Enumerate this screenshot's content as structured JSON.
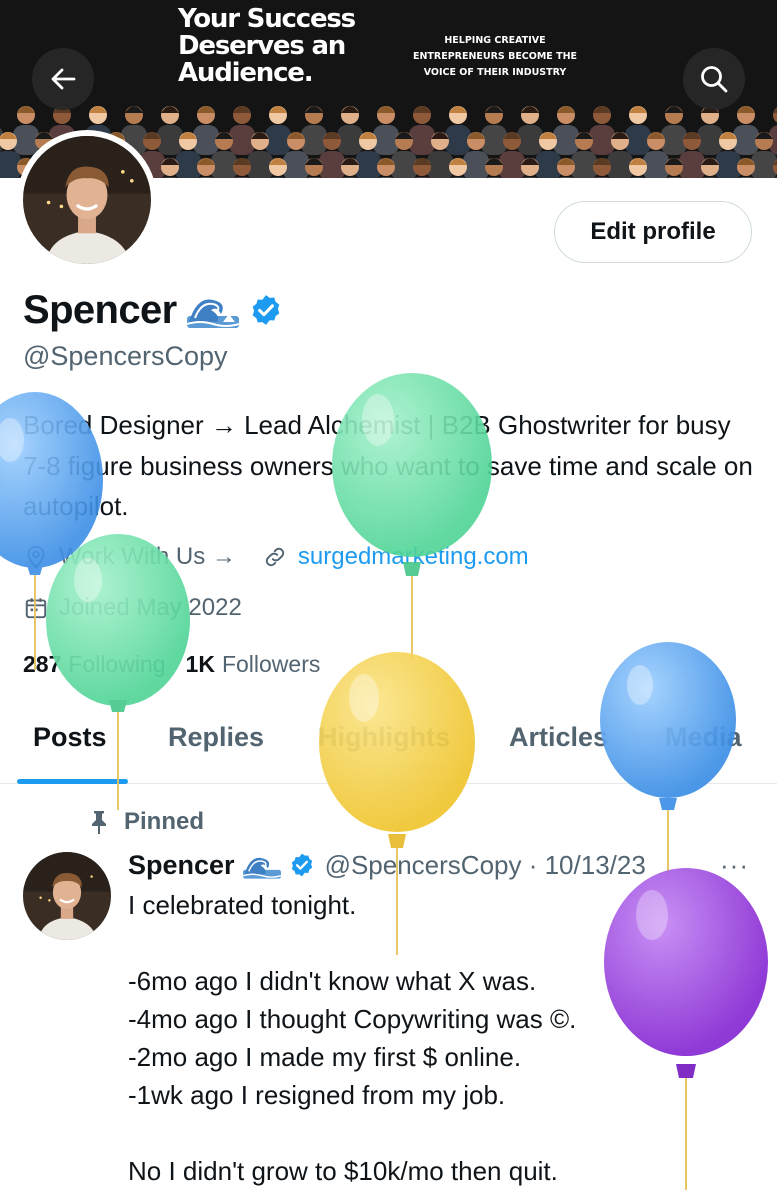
{
  "banner": {
    "title": "Your Success\nDeserves an\nAudience.",
    "tagline": "HELPING CREATIVE\nENTREPRENEURS BECOME THE\nVOICE OF THEIR INDUSTRY"
  },
  "nav": {
    "back_icon": "arrow-left-icon",
    "search_icon": "search-icon"
  },
  "profile": {
    "edit_label": "Edit profile",
    "display_name": "Spencer",
    "handle": "@SpencersCopy",
    "bio": "Bored Designer → Lead Alchemist | B2B Ghostwriter for busy 7-8 figure business owners who want to save time and scale on autopilot.",
    "work_label": "Work With Us →",
    "website": "surgedmarketing.com",
    "joined": "Joined May 2022",
    "following_count": "287",
    "following_label": "Following",
    "followers_count": "1K",
    "followers_label": "Followers"
  },
  "tabs": [
    {
      "label": "Posts",
      "active": true
    },
    {
      "label": "Replies",
      "active": false
    },
    {
      "label": "Highlights",
      "active": false
    },
    {
      "label": "Articles",
      "active": false
    },
    {
      "label": "Media",
      "active": false
    }
  ],
  "post": {
    "pinned_label": "Pinned",
    "author_name": "Spencer",
    "author_handle_date": "@SpencersCopy · 10/13/23",
    "more_label": "···",
    "lines": [
      "I celebrated tonight.",
      "",
      "-6mo ago I didn't know what X was.",
      "-4mo ago I thought Copywriting was ©.",
      "-2mo ago I made my first $ online.",
      "-1wk ago I resigned from my job.",
      "",
      "No I didn't grow to $10k/mo then quit."
    ]
  },
  "colors": {
    "accent": "#1d9bf0",
    "muted": "#536471",
    "text": "#0f1419",
    "balloon_blue": "#5aa8f2",
    "balloon_green": "#6ee0a8",
    "balloon_yellow": "#f5d34c",
    "balloon_purple": "#a044e0"
  }
}
